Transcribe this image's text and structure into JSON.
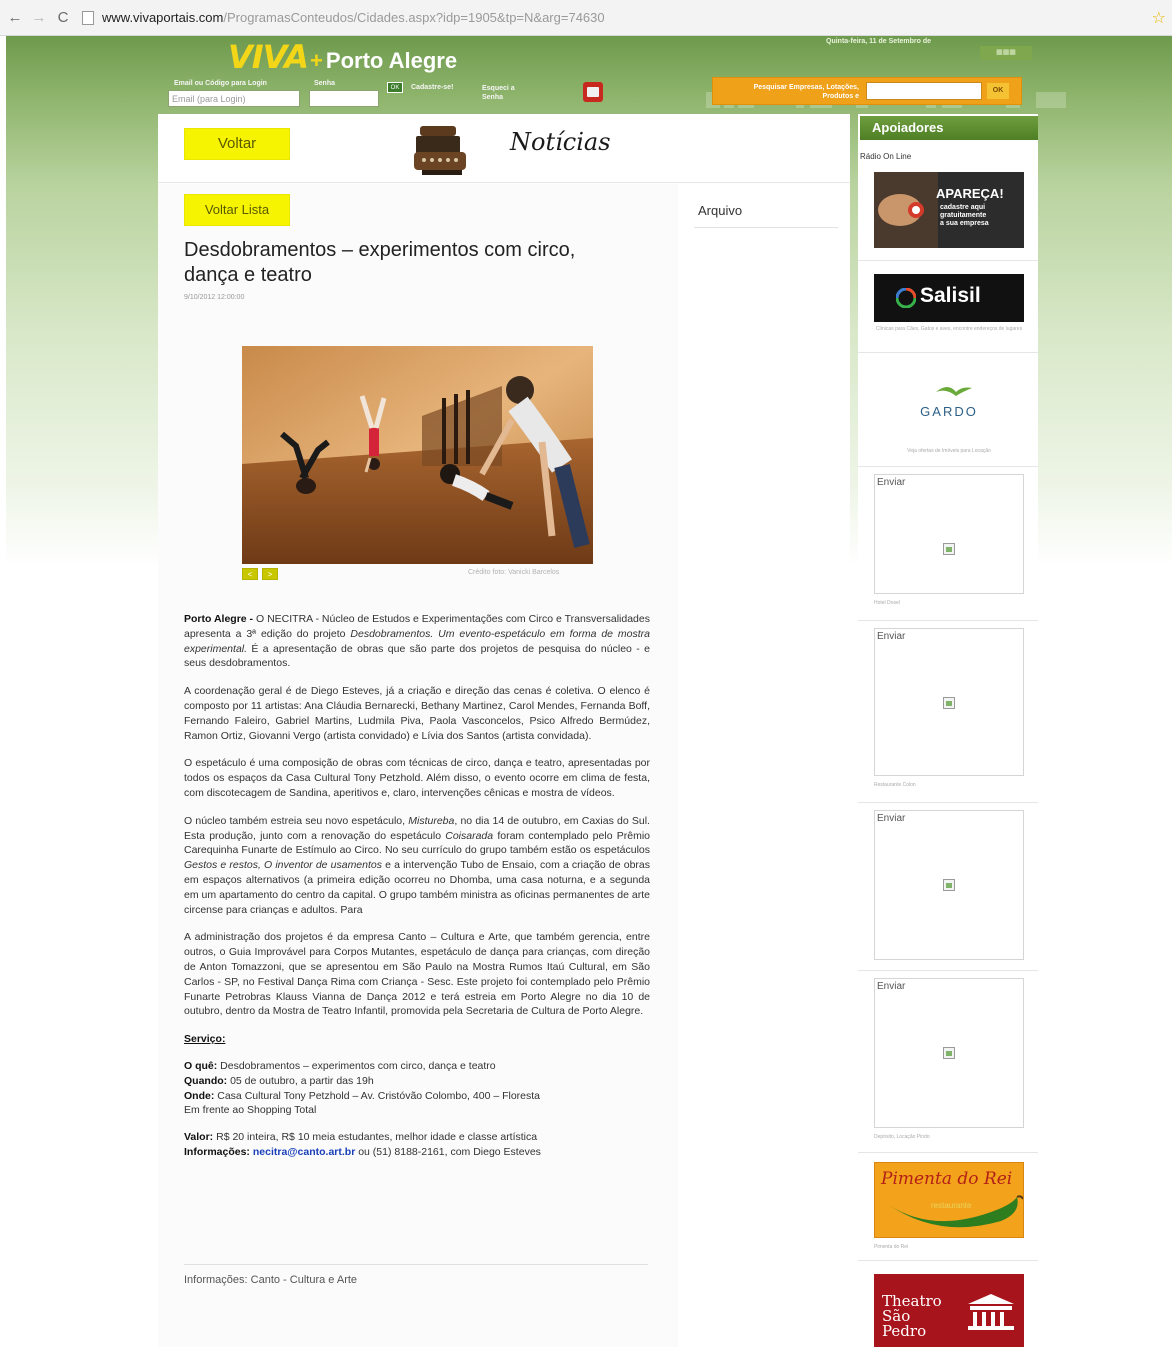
{
  "browser": {
    "url_host": "www.vivaportais.com",
    "url_path": "/ProgramasConteudos/Cidades.aspx?idp=1905&tp=N&arg=74630"
  },
  "header": {
    "logo_viva": "VIVA",
    "logo_plus": "+",
    "logo_city": "Porto Alegre",
    "date_text": "Quinta-feira, 11 de Setembro de",
    "login": {
      "email_label": "Email ou Código para Login",
      "email_placeholder": "Email (para Login)",
      "password_label": "Senha",
      "ok_label": "OK",
      "register_link": "Cadastre-se!",
      "forgot_link": "Esqueci a Senha"
    },
    "search": {
      "label": "Pesquisar Empresas, Lotações, Produtos e",
      "button": "OK"
    }
  },
  "main": {
    "back_button": "Voltar",
    "section_title": "Notícias",
    "back_list_button": "Voltar Lista",
    "archive_label": "Arquivo",
    "article": {
      "title": "Desdobramentos – experimentos com circo, dança e teatro",
      "date": "9/10/2012 12:00:00",
      "photo_credit": "Crédito foto: Vanicki Barcelos",
      "photo_prev": "<",
      "photo_next": ">",
      "p1_lead": "Porto Alegre -",
      "p1_a": " O NECITRA - Núcleo de Estudos e Experimentações com Circo e Transversalidades apresenta a 3ª edição do projeto ",
      "p1_em1": "Desdobramentos. Um evento-espetáculo em forma de mostra experimental.",
      "p1_b": " É a apresentação de obras que são parte dos projetos de pesquisa do núcleo - e seus desdobramentos.",
      "p2": "A coordenação geral é de Diego Esteves, já a criação e direção das cenas é coletiva. O elenco é composto por 11 artistas: Ana Cláudia Bernarecki, Bethany Martinez, Carol Mendes, Fernanda Boff, Fernando Faleiro, Gabriel Martins, Ludmila Piva, Paola Vasconcelos, Psico Alfredo Bermúdez, Ramon Ortiz, Giovanni Vergo (artista convidado) e Lívia dos Santos (artista convidada).",
      "p3": "O espetáculo é uma composição de obras com técnicas de circo, dança e teatro, apresentadas por todos os espaços da Casa Cultural Tony Petzhold. Além disso, o evento ocorre em clima de festa, com discotecagem de Sandina, aperitivos e, claro, intervenções cênicas e mostra de vídeos.",
      "p4_a": "O núcleo também estreia seu novo espetáculo, ",
      "p4_em1": "Mistureba",
      "p4_b": ", no dia 14 de outubro, em Caxias do Sul. Esta produção, junto com a renovação do espetáculo ",
      "p4_em2": "Coisarada",
      "p4_c": " foram contemplado pelo Prêmio Carequinha Funarte de Estímulo ao Circo. No seu currículo do grupo também estão os espetáculos ",
      "p4_em3": "Gestos e restos, O inventor de usamentos",
      "p4_d": " e a intervenção Tubo de Ensaio, com a criação de obras em espaços alternativos (a primeira edição ocorreu no Dhomba, uma casa noturna, e a segunda em um apartamento do centro da capital. O grupo também ministra as oficinas permanentes de arte circense para crianças e adultos. Para",
      "p5": "A administração dos projetos é da empresa Canto – Cultura e Arte, que também gerencia, entre outros, o Guia Improvável para Corpos Mutantes, espetáculo de dança para crianças, com direção de Anton Tomazzoni, que se apresentou em São Paulo na Mostra Rumos Itaú Cultural, em São Carlos - SP, no Festival Dança Rima com Criança - Sesc. Este projeto foi contemplado pelo Prêmio Funarte Petrobras Klauss Vianna de Dança 2012 e terá estreia em Porto Alegre no dia 10 de outubro, dentro da Mostra de Teatro Infantil, promovida pela Secretaria de Cultura de Porto Alegre.",
      "service_title": "Serviço:",
      "what_label": "O quê:",
      "what_value": " Desdobramentos – experimentos com circo, dança e teatro",
      "when_label": "Quando:",
      "when_value": " 05 de outubro, a partir das 19h",
      "where_label": "Onde:",
      "where_value": " Casa Cultural Tony Petzhold – Av. Cristóvão Colombo, 400 – Floresta",
      "where_value2": "Em frente ao Shopping Total",
      "price_label": "Valor:",
      "price_value": " R$ 20 inteira, R$ 10 meia estudantes, melhor idade e classe artística",
      "info_label": "Informações:",
      "info_email": " necitra@canto.art.br",
      "info_value": " ou (51) 8188-2161, com Diego Esteves",
      "footer_info": "Informações: Canto - Cultura e Arte"
    }
  },
  "sidebar": {
    "header": "Apoiadores",
    "sub_label": "Rádio On Line",
    "ad1_title": "APAREÇA!",
    "ad1_line1": "cadastre aqui",
    "ad1_line2": "gratuitamente",
    "ad1_line3": "a sua empresa",
    "ad2_brand": "Salisil",
    "ad2_caption": "Clínicas para Cães, Gatos e aves, encontre endereços de lugares",
    "ad3_brand": "GARDO",
    "ad3_caption": "Veja ofertas de Imóveis para Locação",
    "enviar_label": "Enviar",
    "enviar_caption1": "Hotel Dosel",
    "enviar_caption2": "Restaurante Colon",
    "enviar_caption4": "Depósito, Locação Pindo",
    "ad4_brand": "Pimenta do Rei",
    "ad4_sub": "restaurante",
    "ad4_caption": "Pimenta do Rei",
    "ad5_brand": "Theatro São Pedro"
  }
}
